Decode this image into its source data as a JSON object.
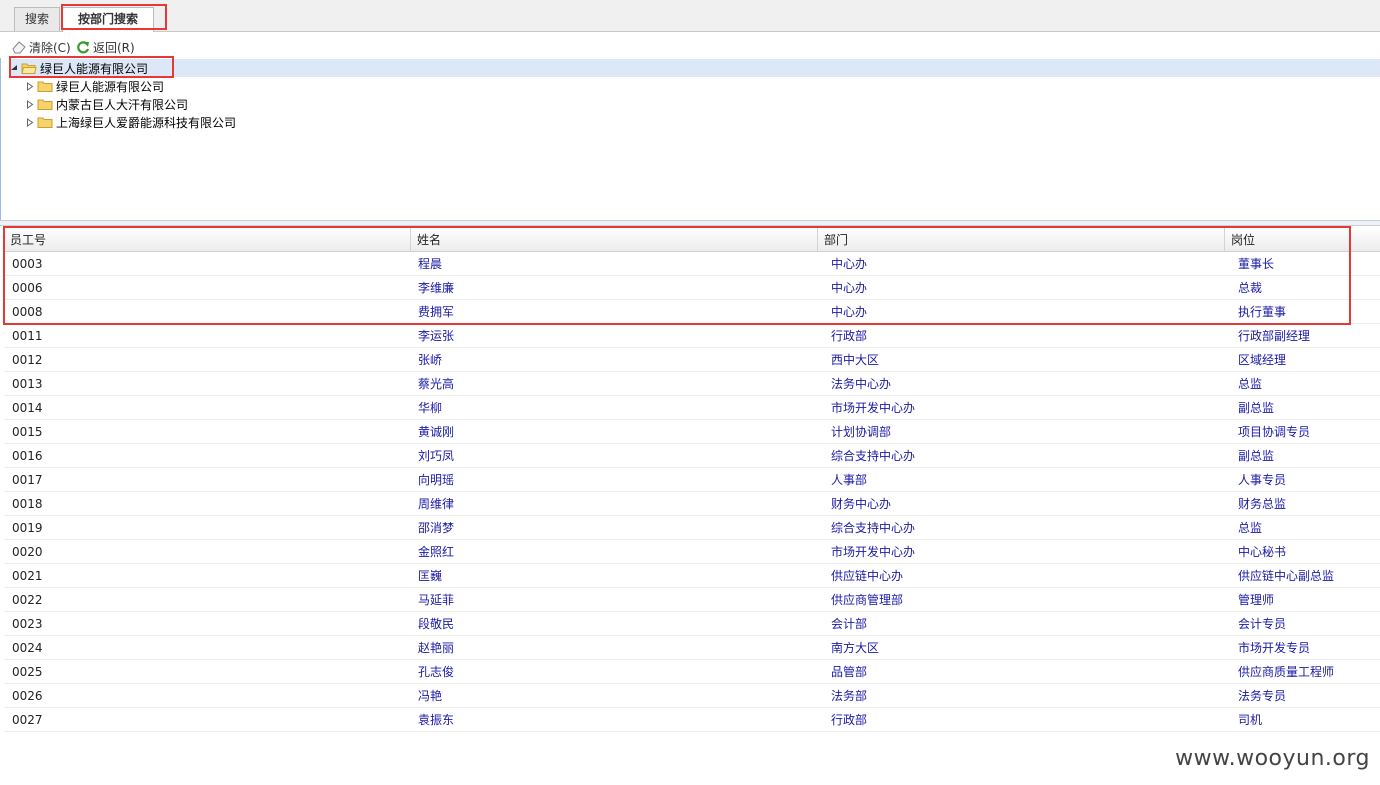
{
  "tabs": [
    {
      "label": "搜索"
    },
    {
      "label": "按部门搜索"
    }
  ],
  "toolbar": {
    "clear_label": "清除(C)",
    "back_label": "返回(R)"
  },
  "tree": {
    "root": "绿巨人能源有限公司",
    "children": [
      {
        "label": "绿巨人能源有限公司"
      },
      {
        "label": "内蒙古巨人大汗有限公司"
      },
      {
        "label": "上海绿巨人爱爵能源科技有限公司"
      }
    ]
  },
  "grid": {
    "columns": [
      "员工号",
      "姓名",
      "部门",
      "岗位"
    ],
    "rows": [
      {
        "id": "0003",
        "name": "程晨",
        "dept": "中心办",
        "pos": "董事长"
      },
      {
        "id": "0006",
        "name": "李维廉",
        "dept": "中心办",
        "pos": "总裁"
      },
      {
        "id": "0008",
        "name": "费拥军",
        "dept": "中心办",
        "pos": "执行董事"
      },
      {
        "id": "0011",
        "name": "李运张",
        "dept": "行政部",
        "pos": "行政部副经理"
      },
      {
        "id": "0012",
        "name": "张峤",
        "dept": "西中大区",
        "pos": "区域经理"
      },
      {
        "id": "0013",
        "name": "蔡光高",
        "dept": "法务中心办",
        "pos": "总监"
      },
      {
        "id": "0014",
        "name": "华柳",
        "dept": "市场开发中心办",
        "pos": "副总监"
      },
      {
        "id": "0015",
        "name": "黄诚刚",
        "dept": "计划协调部",
        "pos": "项目协调专员"
      },
      {
        "id": "0016",
        "name": "刘巧凤",
        "dept": "综合支持中心办",
        "pos": "副总监"
      },
      {
        "id": "0017",
        "name": "向明瑶",
        "dept": "人事部",
        "pos": "人事专员"
      },
      {
        "id": "0018",
        "name": "周维律",
        "dept": "财务中心办",
        "pos": "财务总监"
      },
      {
        "id": "0019",
        "name": "邵消梦",
        "dept": "综合支持中心办",
        "pos": "总监"
      },
      {
        "id": "0020",
        "name": "金照红",
        "dept": "市场开发中心办",
        "pos": "中心秘书"
      },
      {
        "id": "0021",
        "name": "匡巍",
        "dept": "供应链中心办",
        "pos": "供应链中心副总监"
      },
      {
        "id": "0022",
        "name": "马延菲",
        "dept": "供应商管理部",
        "pos": "管理师"
      },
      {
        "id": "0023",
        "name": "段敬民",
        "dept": "会计部",
        "pos": "会计专员"
      },
      {
        "id": "0024",
        "name": "赵艳丽",
        "dept": "南方大区",
        "pos": "市场开发专员"
      },
      {
        "id": "0025",
        "name": "孔志俊",
        "dept": "品管部",
        "pos": "供应商质量工程师"
      },
      {
        "id": "0026",
        "name": "冯艳",
        "dept": "法务部",
        "pos": "法务专员"
      },
      {
        "id": "0027",
        "name": "袁振东",
        "dept": "行政部",
        "pos": "司机"
      }
    ]
  },
  "watermark": "www.wooyun.org",
  "colors": {
    "highlight": "#e53935",
    "link": "#1a1aa6",
    "selected_node": "#dce8f7"
  }
}
